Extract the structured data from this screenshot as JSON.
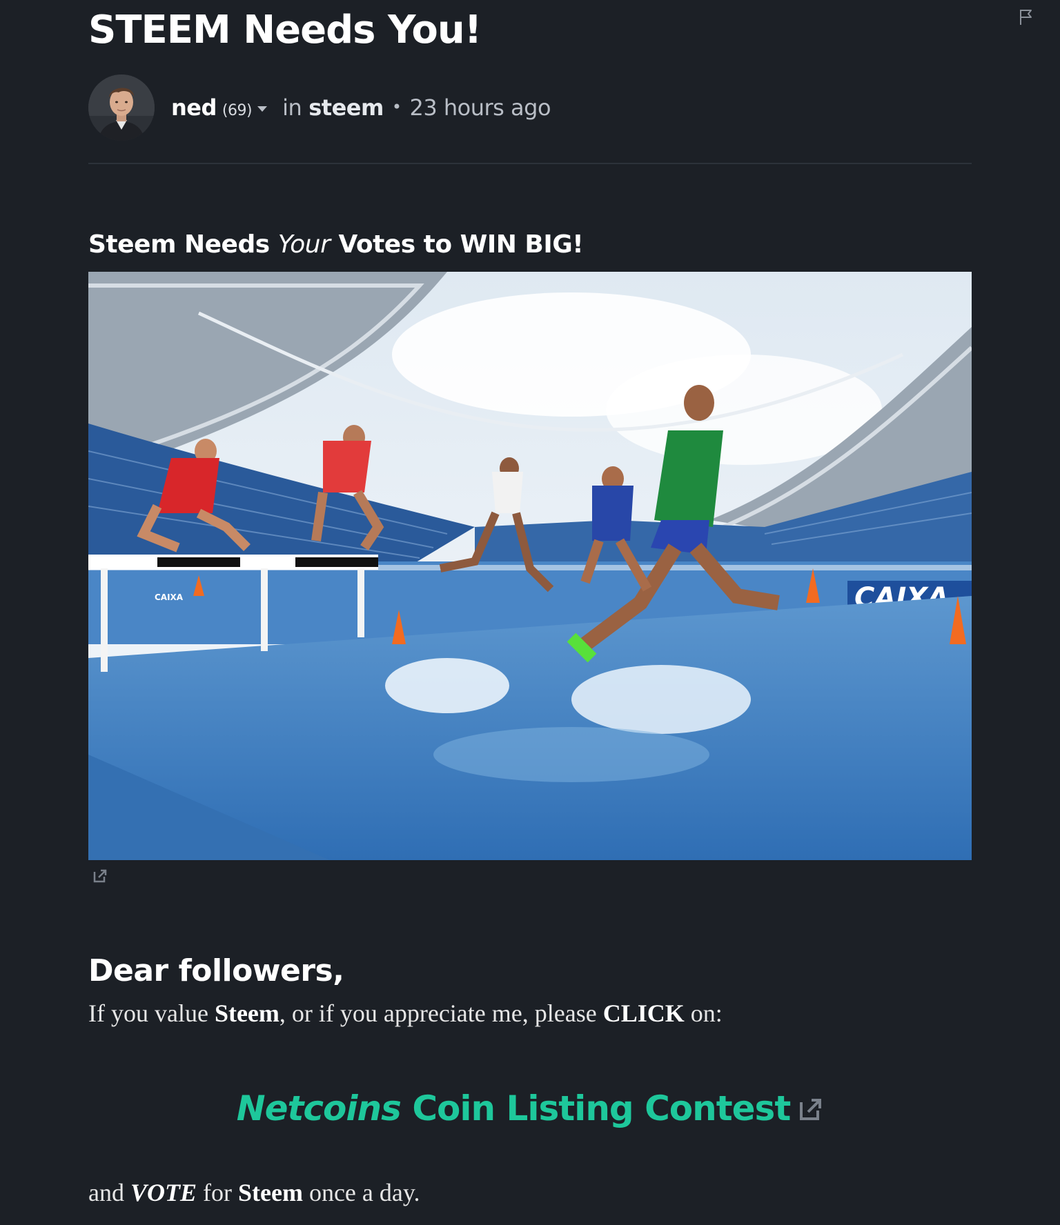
{
  "post": {
    "title": "STEEM Needs You!",
    "author": "ned",
    "reputation": "(69)",
    "in_label": "in",
    "category": "steem",
    "bullet": "•",
    "time_ago": "23 hours ago"
  },
  "body": {
    "heading_part1": "Steem Needs",
    "heading_em": "Your",
    "heading_part2": "Votes to WIN BIG!",
    "greeting": "Dear followers,",
    "p1_a": "If you value",
    "p1_b": "Steem",
    "p1_c": ", or if you appreciate me, please",
    "p1_d": "CLICK",
    "p1_e": "on:",
    "link_em": "Netcoins",
    "link_rest": "Coin Listing Contest",
    "p2_a": "and",
    "p2_b": "VOTE",
    "p2_c": "for",
    "p2_d": "Steem",
    "p2_e": "once a day."
  },
  "hero": {
    "banner_text": "CAIXA",
    "hurdle_text": "CAIXA"
  },
  "icons": {
    "flag": "flag-icon",
    "caret": "caret-down-icon",
    "external": "external-link-icon"
  },
  "colors": {
    "background": "#1c2026",
    "accent": "#1ec79b",
    "text": "#e6e6e6"
  }
}
